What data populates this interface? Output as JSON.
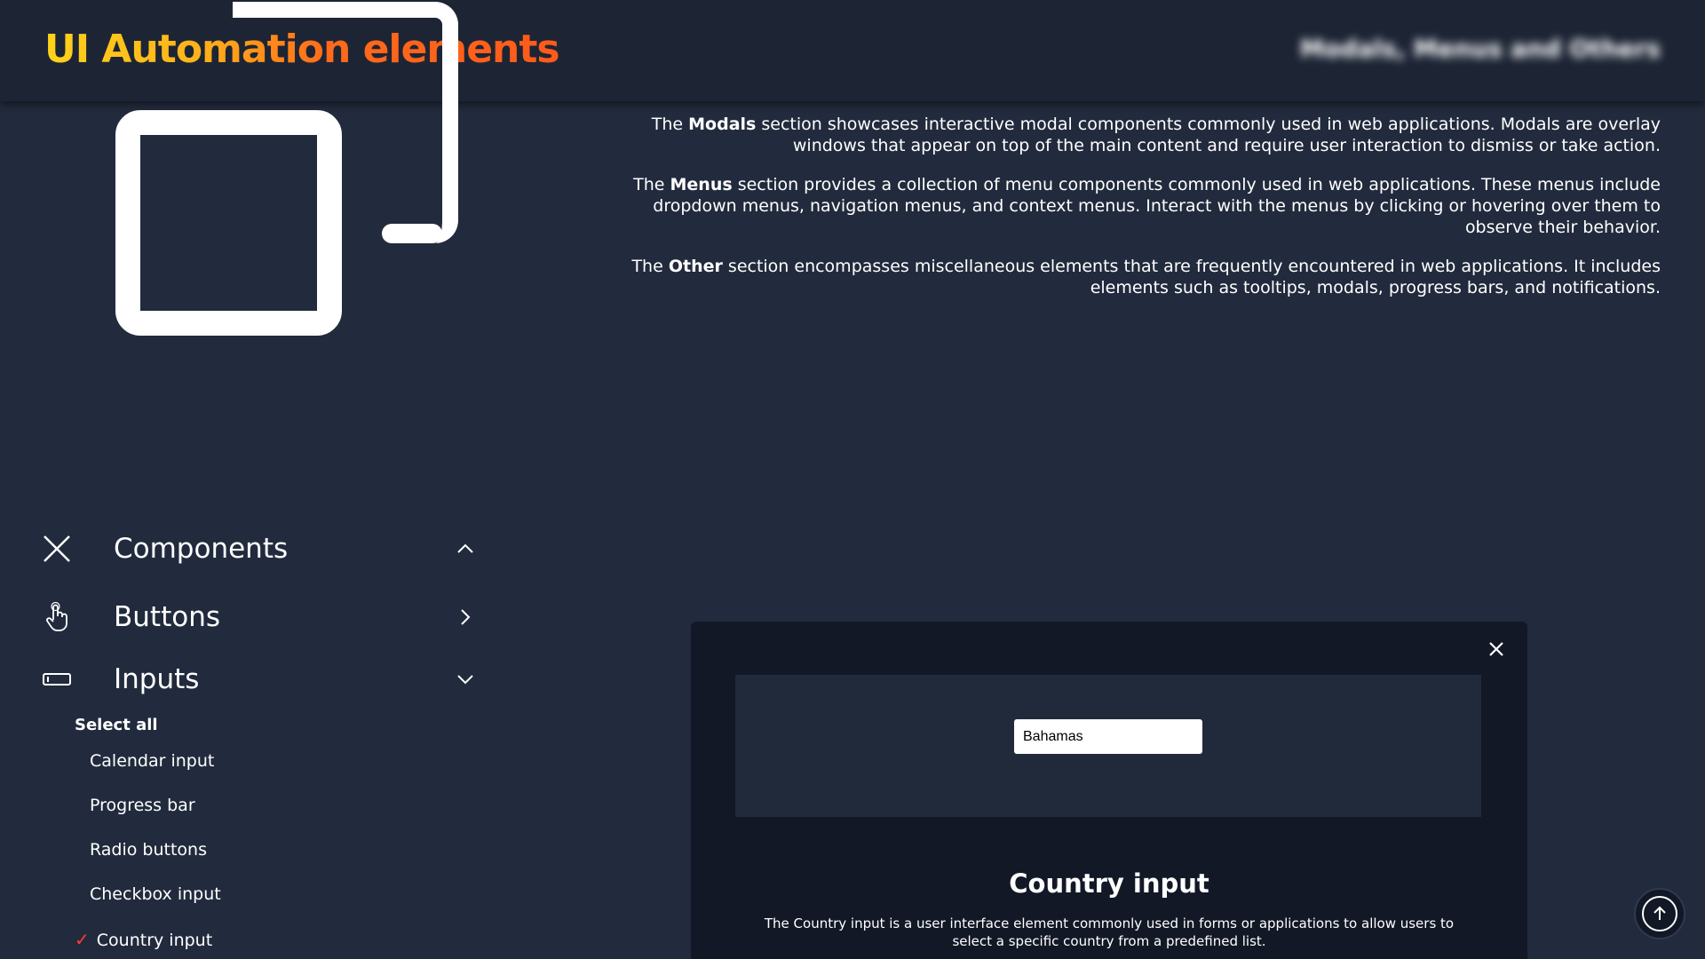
{
  "header": {
    "title": "UI Automation elements",
    "nav": "Modals, Menus and Others"
  },
  "descriptions": [
    {
      "prefix": "The ",
      "bold": "Modals",
      "rest": " section showcases interactive modal components commonly used in web applications. Modals are overlay windows that appear on top of the main content and require user interaction to dismiss or take action."
    },
    {
      "prefix": "The ",
      "bold": "Menus",
      "rest": " section provides a collection of menu components commonly used in web applications. These menus include dropdown menus, navigation menus, and context menus. Interact with the menus by clicking or hovering over them to observe their behavior."
    },
    {
      "prefix": "The ",
      "bold": "Other",
      "rest": " section encompasses miscellaneous elements that are frequently encountered in web applications. It includes elements such as tooltips, modals, progress bars, and notifications."
    }
  ],
  "sidebar": {
    "components": {
      "label": "Components",
      "icon": "close-icon",
      "chevron": "chevron-up-icon"
    },
    "buttons": {
      "label": "Buttons",
      "icon": "hand-pointer-icon",
      "chevron": "chevron-right-icon"
    },
    "inputs": {
      "label": "Inputs",
      "icon": "input-field-icon",
      "chevron": "chevron-down-icon"
    },
    "select_all": "Select all",
    "input_items": [
      {
        "label": "Calendar input",
        "checked": false
      },
      {
        "label": "Progress bar",
        "checked": false
      },
      {
        "label": "Radio buttons",
        "checked": false
      },
      {
        "label": "Checkbox input",
        "checked": false
      },
      {
        "label": "Country input",
        "checked": true
      }
    ],
    "check_mark": "✓"
  },
  "modal": {
    "input_value": "Bahamas",
    "title": "Country input",
    "description": "The Country input is a user interface element commonly used in forms or applications to allow users to select a specific country from a predefined list."
  },
  "colors": {
    "background": "#222b3d",
    "header": "#1d2535",
    "modal": "#121826",
    "title_gradient_start": "#ffd21a",
    "title_gradient_end": "#ff5a1a",
    "check_mark": "#ff3a3a"
  }
}
